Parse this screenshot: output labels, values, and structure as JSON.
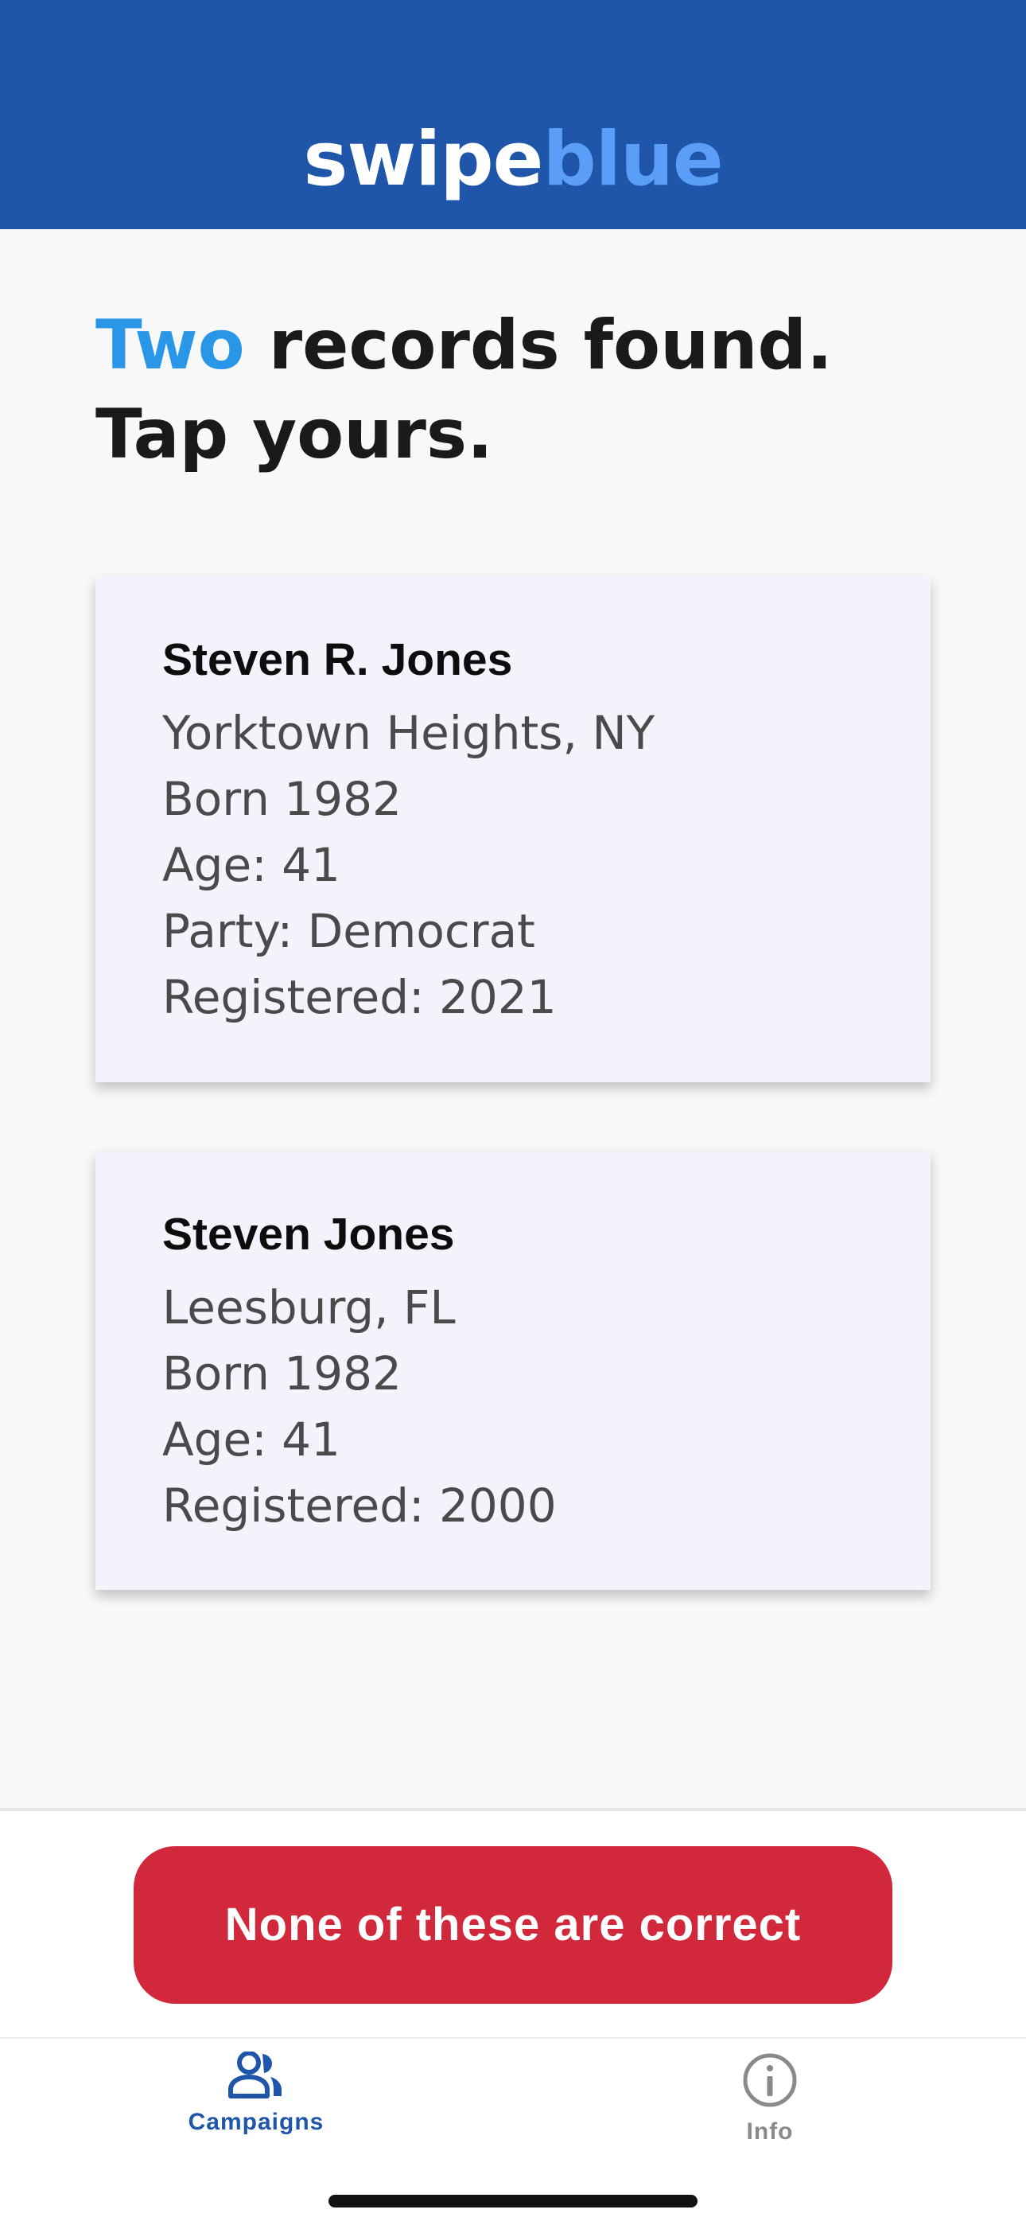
{
  "header": {
    "logo_part1": "swipe",
    "logo_part2": "blue"
  },
  "headline": {
    "accent": "Two",
    "rest": " records found.",
    "line2": "Tap yours."
  },
  "records": [
    {
      "name": "Steven R. Jones",
      "location": "Yorktown Heights, NY",
      "born": "Born 1982",
      "age": "Age: 41",
      "party": "Party: Democrat",
      "registered": "Registered: 2021"
    },
    {
      "name": "Steven Jones",
      "location": "Leesburg, FL",
      "born": "Born 1982",
      "age": "Age: 41",
      "registered": "Registered: 2000"
    }
  ],
  "cta_label": "None of these are correct",
  "tabs": [
    {
      "label": "Campaigns",
      "icon": "people-icon",
      "active": true
    },
    {
      "label": "Info",
      "icon": "info-icon",
      "active": false
    }
  ],
  "colors": {
    "header_bg": "#2056aa",
    "accent_blue": "#2a96e8",
    "logo_blue": "#5a9ef8",
    "cta_red": "#d2283c"
  }
}
